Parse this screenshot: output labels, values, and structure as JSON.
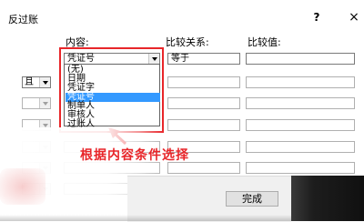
{
  "window": {
    "title": "反过账",
    "help_glyph": "?",
    "close_glyph": "×"
  },
  "headers": {
    "content": "内容:",
    "relation": "比较关系:",
    "value": "比较值:"
  },
  "rows": [
    {
      "logic": "",
      "content": "凭证号",
      "relation": "等于"
    },
    {
      "logic": "且",
      "content": "",
      "relation": ""
    },
    {
      "logic": "",
      "content": "",
      "relation": ""
    },
    {
      "logic": "",
      "content": "",
      "relation": ""
    },
    {
      "logic": "",
      "content": "",
      "relation": ""
    },
    {
      "logic": "",
      "content": "",
      "relation": ""
    },
    {
      "logic": "",
      "content": "",
      "relation": ""
    }
  ],
  "dropdown": {
    "options": [
      "(无)",
      "日期",
      "凭证字",
      "凭证号",
      "制单人",
      "审核人",
      "过账人"
    ],
    "selected_index": 3
  },
  "annotation": "根据内容条件选择",
  "buttons": {
    "done": "完成"
  },
  "colors": {
    "highlight": "#e8262a",
    "selection": "#3399ff"
  }
}
